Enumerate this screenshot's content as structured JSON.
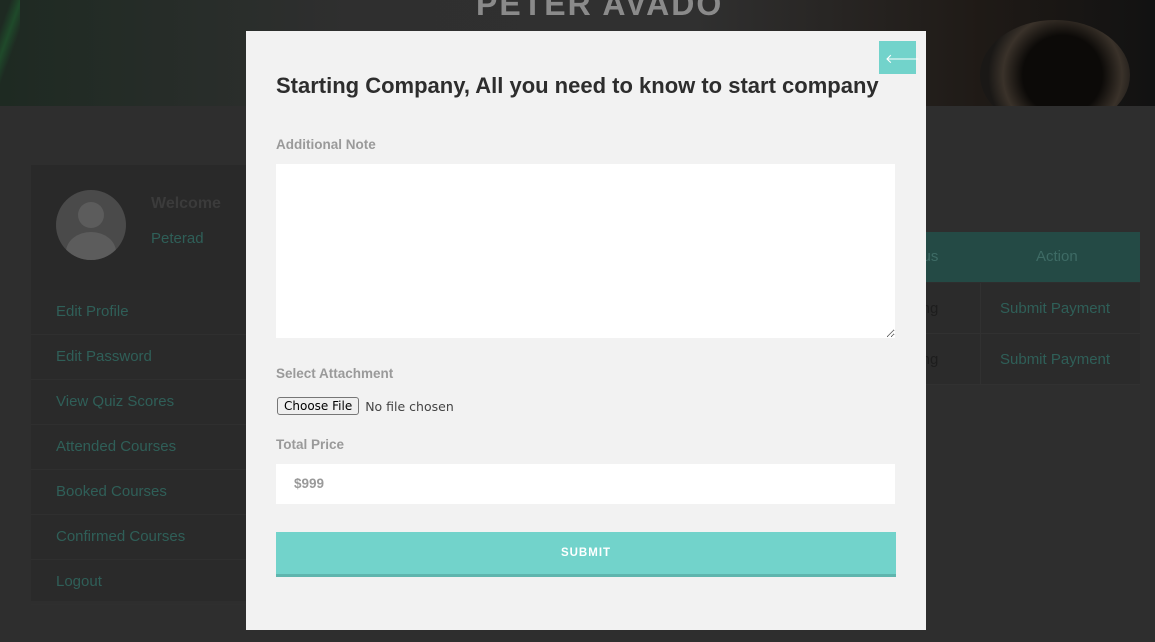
{
  "background": {
    "hero_title": "PETER AVADO",
    "profile": {
      "welcome": "Welcome",
      "username": "Peterad"
    },
    "menu": [
      {
        "label": "Edit Profile"
      },
      {
        "label": "Edit Password"
      },
      {
        "label": "View Quiz Scores"
      },
      {
        "label": "Attended Courses"
      },
      {
        "label": "Booked Courses"
      },
      {
        "label": "Confirmed Courses"
      },
      {
        "label": "Logout"
      }
    ],
    "table": {
      "headers": {
        "status": "atus",
        "action": "Action"
      },
      "rows": [
        {
          "status": "ding",
          "action": "Submit Payment"
        },
        {
          "status": "ding",
          "action": "Submit Payment"
        }
      ]
    }
  },
  "modal": {
    "back_icon": "arrow-left-icon",
    "back_glyph": "🡐",
    "title": "Starting Company, All you need to know to start company",
    "note_label": "Additional Note",
    "note_value": "",
    "attachment_label": "Select Attachment",
    "file_button": "Choose File",
    "file_status": "No file chosen",
    "price_label": "Total Price",
    "price_value": "$999",
    "submit_label": "SUBMIT"
  },
  "colors": {
    "accent": "#72d3cb",
    "modal_bg": "#f2f2f2",
    "overlay_bg": "#2e2e2e"
  }
}
